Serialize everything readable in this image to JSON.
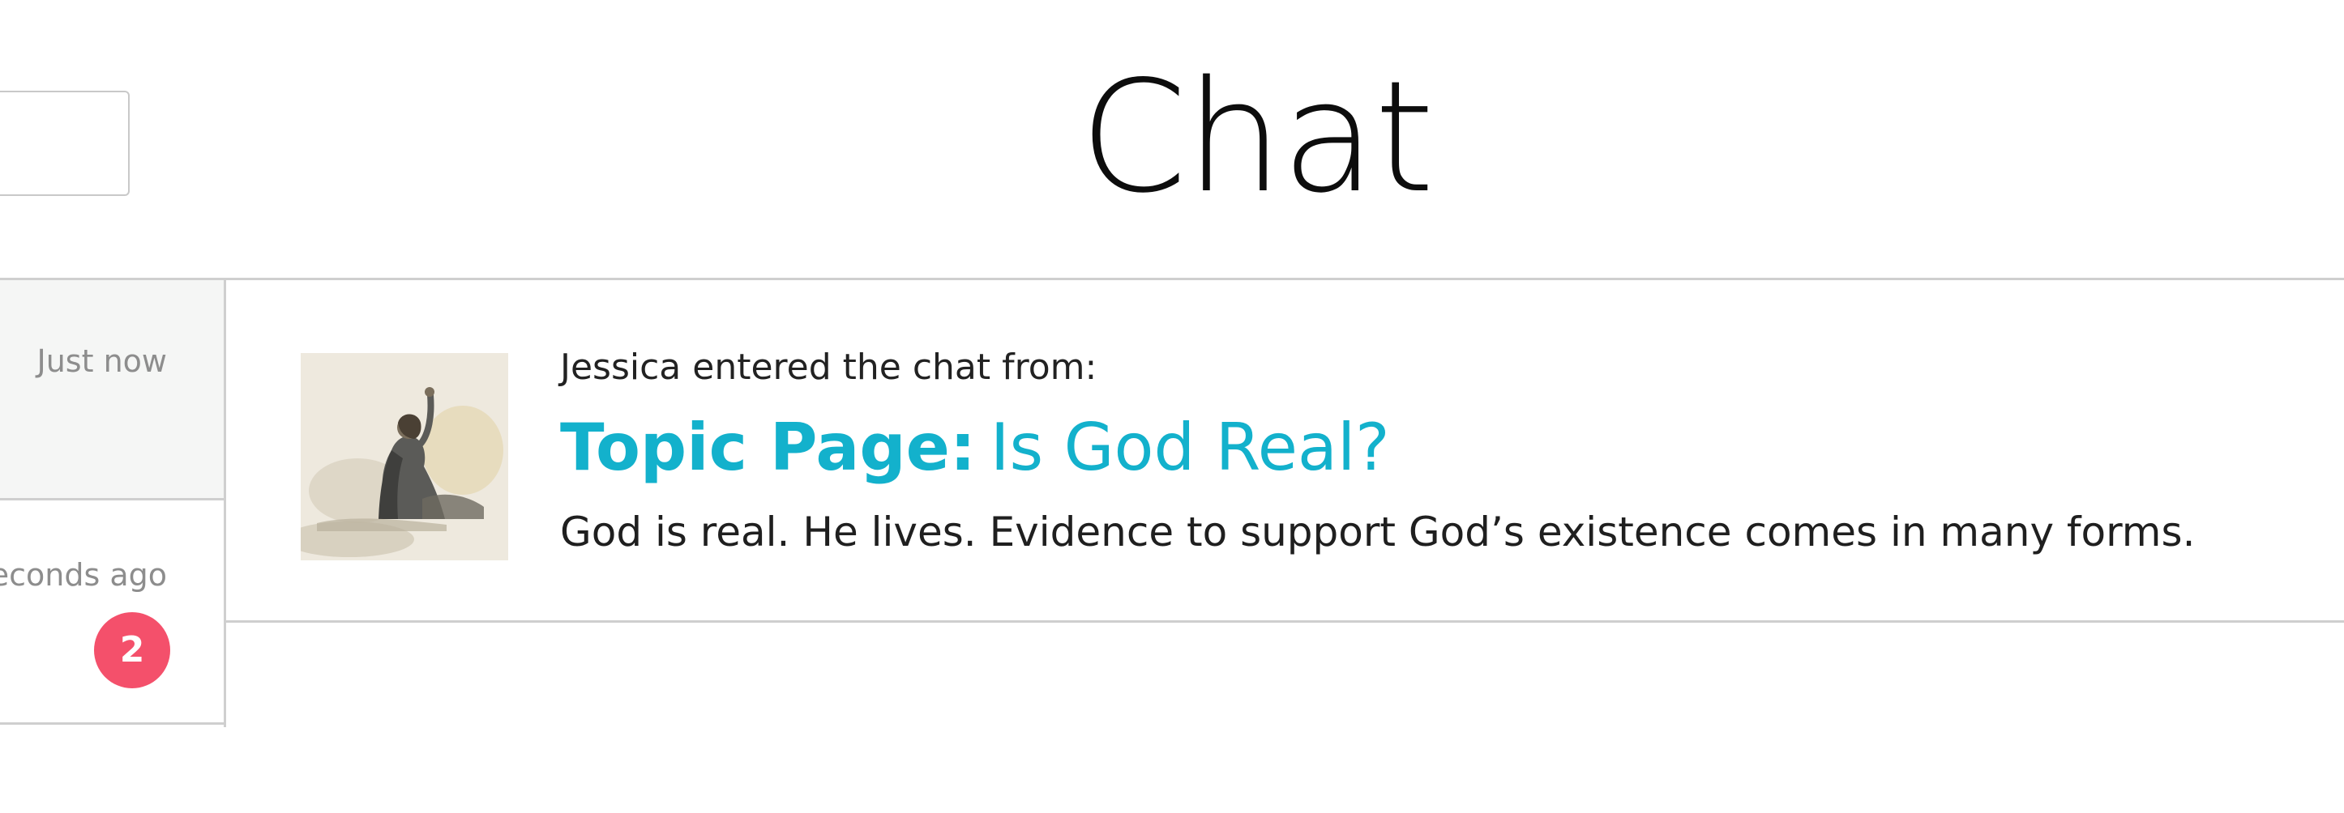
{
  "header": {
    "title": "Chat"
  },
  "conversations": [
    {
      "time": "Just now",
      "unread": ""
    },
    {
      "time": "seconds ago",
      "unread": "2"
    }
  ],
  "message": {
    "meta": "Jessica entered the chat from:",
    "source_label": "Topic Page:",
    "topic_title": "Is God Real?",
    "excerpt": "God is real. He lives. Evidence to support God’s existence comes in many forms.",
    "thumbnail_icon": "illustration-thumbnail-icon"
  },
  "colors": {
    "accent": "#13b1cc",
    "badge": "#f4506b",
    "divider": "#cfcfcf"
  }
}
